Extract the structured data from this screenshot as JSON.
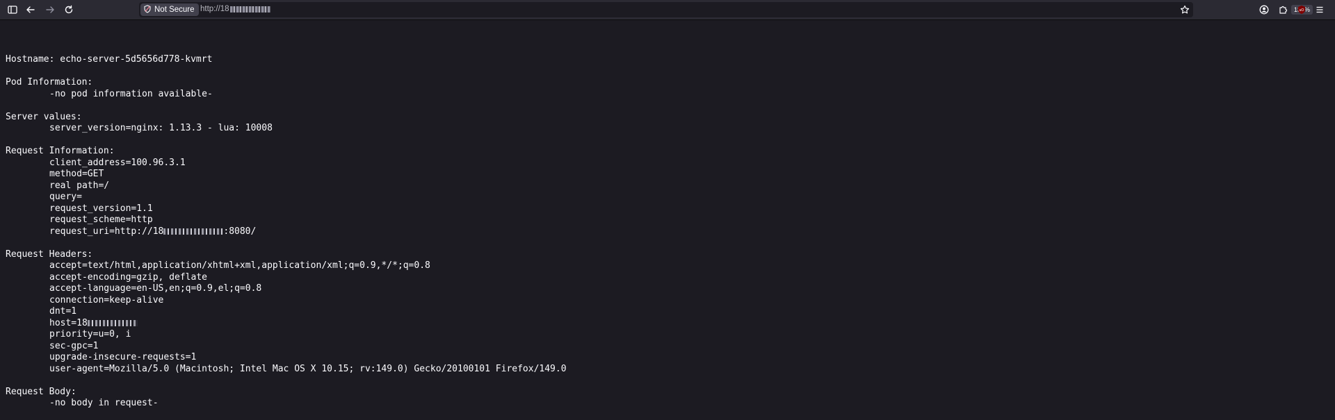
{
  "browser": {
    "security_label": "Not Secure",
    "url_prefix": "http://18",
    "zoom": "133%",
    "icons": {
      "sidebar": "sidebar-icon",
      "back": "back-arrow-icon",
      "forward": "forward-arrow-icon",
      "reload": "reload-icon",
      "shield": "shield-icon",
      "star": "bookmark-star-icon",
      "account": "account-icon",
      "extensions": "extensions-icon",
      "ublock": "ublock-origin-icon",
      "menu": "hamburger-menu-icon"
    }
  },
  "page": {
    "hostname": "Hostname: echo-server-5d5656d778-kvmrt",
    "pod_heading": "Pod Information:",
    "pod_value": "-no pod information available-",
    "server_heading": "Server values:",
    "server_version": "server_version=nginx: 1.13.3 - lua: 10008",
    "request_heading": "Request Information:",
    "request_info": [
      "client_address=100.96.3.1",
      "method=GET",
      "real path=/",
      "query=",
      "request_version=1.1",
      "request_scheme=http"
    ],
    "request_uri_prefix": "request_uri=http://18",
    "request_uri_suffix": ":8080/",
    "headers_heading": "Request Headers:",
    "headers_before_host": [
      "accept=text/html,application/xhtml+xml,application/xml;q=0.9,*/*;q=0.8",
      "accept-encoding=gzip, deflate",
      "accept-language=en-US,en;q=0.9,el;q=0.8",
      "connection=keep-alive",
      "dnt=1"
    ],
    "host_prefix": "host=18",
    "headers_after_host": [
      "priority=u=0, i",
      "sec-gpc=1",
      "upgrade-insecure-requests=1",
      "user-agent=Mozilla/5.0 (Macintosh; Intel Mac OS X 10.15; rv:149.0) Gecko/20100101 Firefox/149.0"
    ],
    "body_heading": "Request Body:",
    "body_value": "-no body in request-"
  }
}
